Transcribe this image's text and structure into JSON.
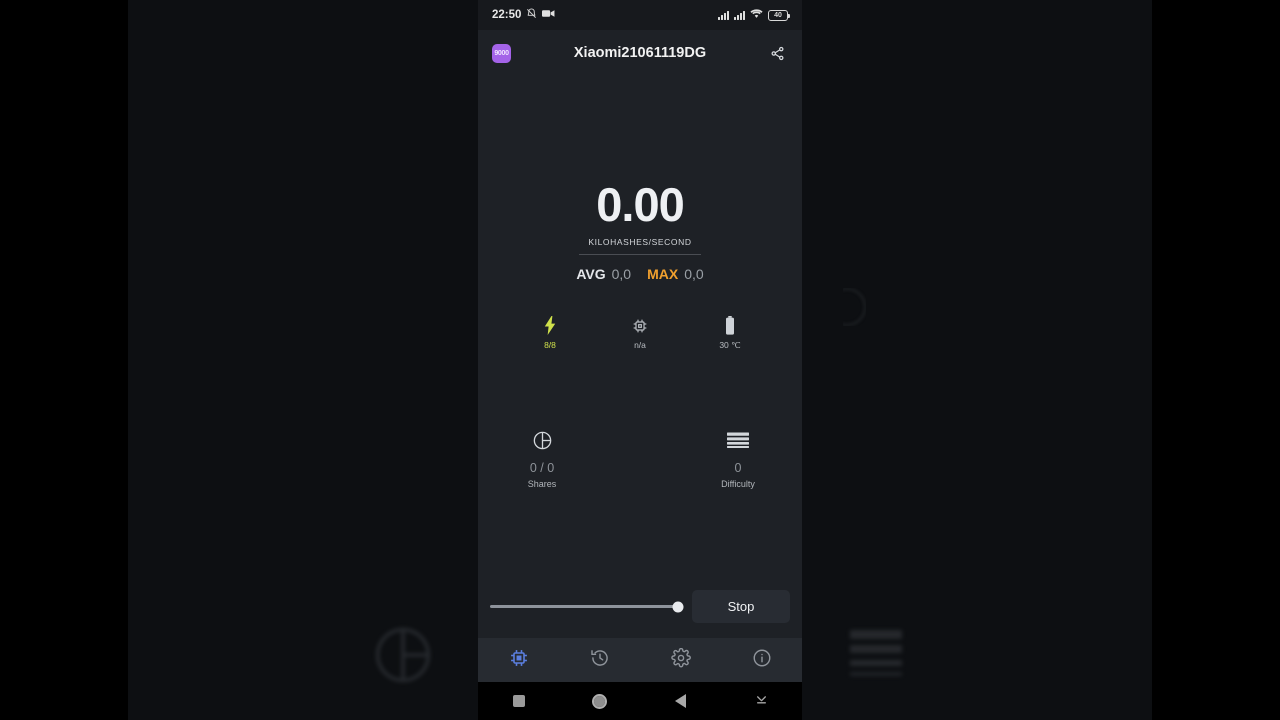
{
  "status_bar": {
    "time": "22:50",
    "mute_icon": "bell-mute-icon",
    "record_icon": "video-camera-icon",
    "signal_icon_1": "signal-bars-icon",
    "signal_icon_2": "signal-bars-icon",
    "wifi_icon": "wifi-icon",
    "battery_level": "40"
  },
  "app_bar": {
    "app_icon_text": "9000",
    "app_icon_color": "#a463e8",
    "title": "Xiaomi21061119DG",
    "share_icon": "share-icon"
  },
  "hashrate": {
    "value": "0.00",
    "unit": "KILOHASHES/SECOND",
    "avg_label": "AVG",
    "avg_value": "0,0",
    "max_label": "MAX",
    "max_value": "0,0",
    "max_color": "#f0a02e"
  },
  "device_stats": [
    {
      "icon": "lightning-bolt-icon",
      "value": "8/8",
      "accent": "#cfe04b"
    },
    {
      "icon": "cpu-chip-icon",
      "value": "n/a",
      "accent": "#b9bdc2"
    },
    {
      "icon": "battery-temperature-icon",
      "value": "30 ℃",
      "accent": "#b9bdc2"
    }
  ],
  "mining_stats": [
    {
      "icon": "pie-chart-icon",
      "value": "0 / 0",
      "label": "Shares"
    },
    {
      "icon": "stacked-bars-icon",
      "value": "0",
      "label": "Difficulty"
    }
  ],
  "controls": {
    "slider_name": "threads-slider",
    "slider_percent": 98,
    "stop_label": "Stop"
  },
  "bottom_nav": [
    {
      "icon": "cpu-chip-icon",
      "name": "miner",
      "active": true,
      "color": "#5b7fe0"
    },
    {
      "icon": "history-clock-icon",
      "name": "history",
      "active": false,
      "color": "#8f949b"
    },
    {
      "icon": "gear-icon",
      "name": "settings",
      "active": false,
      "color": "#8f949b"
    },
    {
      "icon": "info-circle-icon",
      "name": "info",
      "active": false,
      "color": "#8f949b"
    }
  ],
  "system_nav": [
    {
      "icon": "recents-square-icon",
      "name": "recents"
    },
    {
      "icon": "home-circle-icon",
      "name": "home"
    },
    {
      "icon": "back-triangle-icon",
      "name": "back"
    },
    {
      "icon": "hide-keyboard-icon",
      "name": "hide"
    }
  ]
}
